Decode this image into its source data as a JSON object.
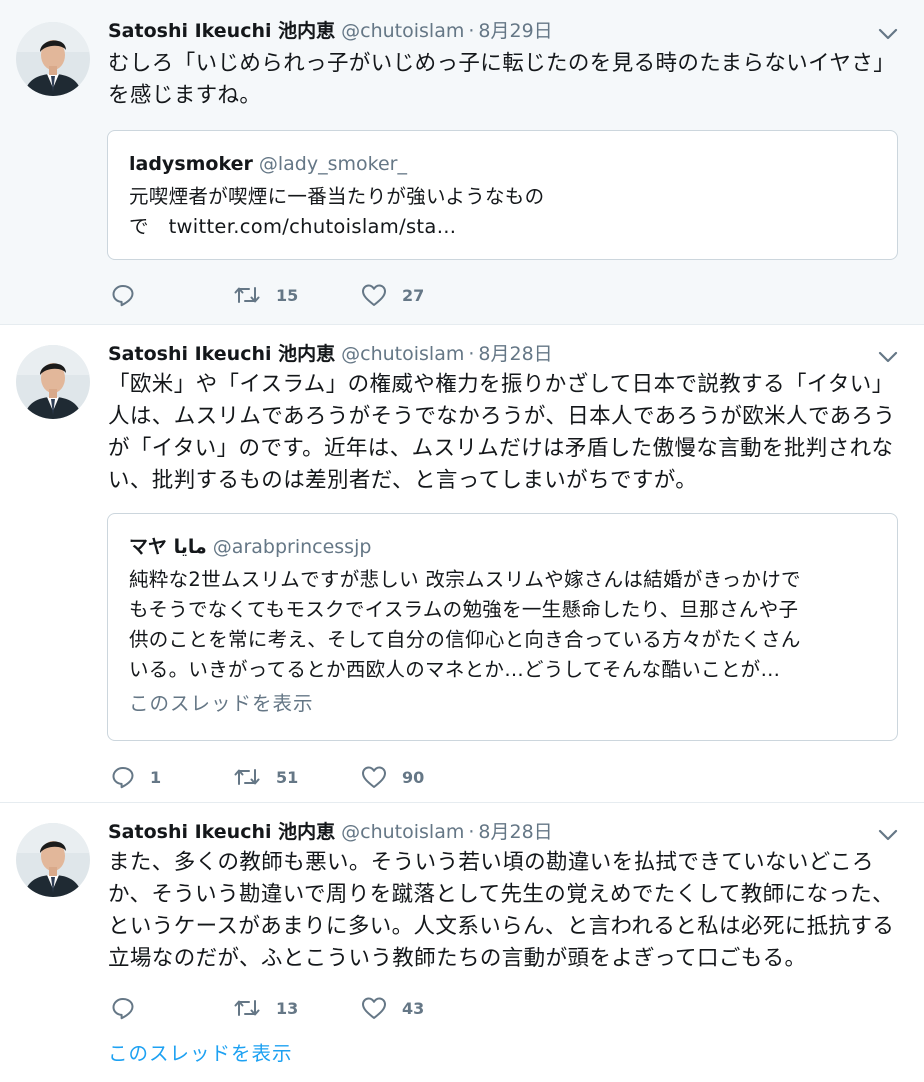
{
  "tweets": [
    {
      "author_name": "Satoshi Ikeuchi 池内恵",
      "handle": "@chutoislam",
      "separator": "·",
      "date": "8月29日",
      "text": "むしろ「いじめられっ子がいじめっ子に転じたのを見る時のたまらないイヤさ」\nを感じますね。",
      "quote": {
        "author_name": "ladysmoker",
        "handle": "@lady_smoker_",
        "text": "元喫煙者が喫煙に一番当たりが強いようなもの\nで　twitter.com/chutoislam/sta…"
      },
      "replies": "",
      "retweets": "15",
      "likes": "27"
    },
    {
      "author_name": "Satoshi Ikeuchi 池内恵",
      "handle": "@chutoislam",
      "separator": "·",
      "date": "8月28日",
      "text": "「欧米」や「イスラム」の権威や権力を振りかざして日本で説教する「イタい」\n人は、ムスリムであろうがそうでなかろうが、日本人であろうが欧米人であろう\nが「イタい」のです。近年は、ムスリムだけは矛盾した傲慢な言動を批判されな\nい、批判するものは差別者だ、と言ってしまいがちですが。",
      "quote": {
        "author_name": "マヤ مايا",
        "handle": "@arabprincessjp",
        "text": "純粋な2世ムスリムですが悲しい 改宗ムスリムや嫁さんは結婚がきっかけで\nもそうでなくてもモスクでイスラムの勉強を一生懸命したり、旦那さんや子\n供のことを常に考え、そして自分の信仰心と向き合っている方々がたくさん\nいる。いきがってるとか西欧人のマネとか…どうしてそんな酷いことが…",
        "show_thread": "このスレッドを表示"
      },
      "replies": "1",
      "retweets": "51",
      "likes": "90"
    },
    {
      "author_name": "Satoshi Ikeuchi 池内恵",
      "handle": "@chutoislam",
      "separator": "·",
      "date": "8月28日",
      "text": "また、多くの教師も悪い。そういう若い頃の勘違いを払拭できていないどころ\nか、そういう勘違いで周りを蹴落として先生の覚えめでたくして教師になった、\nというケースがあまりに多い。人文系いらん、と言われると私は必死に抵抗する\n立場なのだが、ふとこういう教師たちの言動が頭をよぎって口ごもる。",
      "replies": "",
      "retweets": "13",
      "likes": "43",
      "show_thread": "このスレッドを表示"
    }
  ],
  "icons": {
    "avatar": "avatar-photo",
    "chevron": "chevron-down-icon",
    "reply": "reply-icon",
    "retweet": "retweet-icon",
    "like": "heart-icon"
  },
  "colors": {
    "text": "#14171a",
    "muted": "#657786",
    "link": "#1da1f2",
    "border": "#e6ecf0",
    "highlight_bg": "#f5f8fa"
  }
}
